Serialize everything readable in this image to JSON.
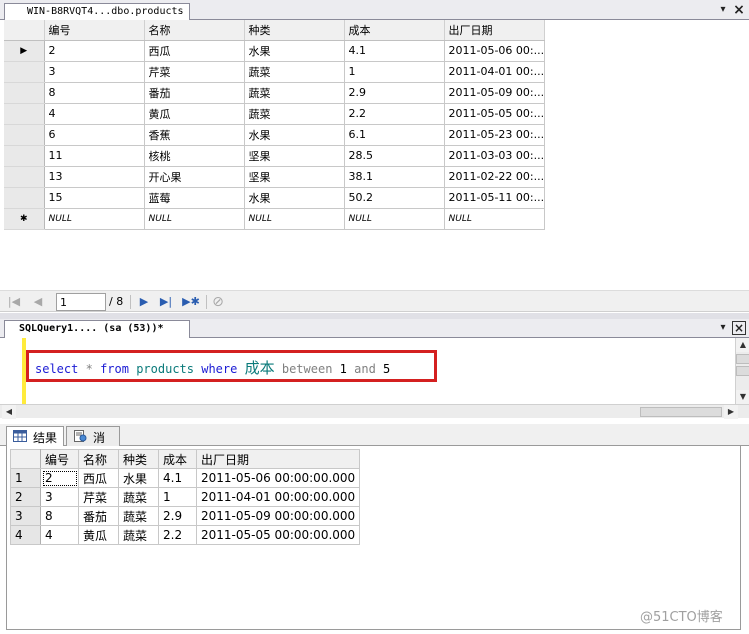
{
  "top_tab": {
    "title": "WIN-B8RVQT4...dbo.products"
  },
  "products_grid": {
    "columns": [
      "编号",
      "名称",
      "种类",
      "成本",
      "出厂日期"
    ],
    "rows": [
      [
        "2",
        "西瓜",
        "水果",
        "4.1",
        "2011-05-06 00:..."
      ],
      [
        "3",
        "芹菜",
        "蔬菜",
        "1",
        "2011-04-01 00:..."
      ],
      [
        "8",
        "番茄",
        "蔬菜",
        "2.9",
        "2011-05-09 00:..."
      ],
      [
        "4",
        "黄瓜",
        "蔬菜",
        "2.2",
        "2011-05-05 00:..."
      ],
      [
        "6",
        "香蕉",
        "水果",
        "6.1",
        "2011-05-23 00:..."
      ],
      [
        "11",
        "核桃",
        "坚果",
        "28.5",
        "2011-03-03 00:..."
      ],
      [
        "13",
        "开心果",
        "坚果",
        "38.1",
        "2011-02-22 00:..."
      ],
      [
        "15",
        "蓝莓",
        "水果",
        "50.2",
        "2011-05-11 00:..."
      ]
    ],
    "new_row_marker": "✱",
    "null_text": "NULL"
  },
  "navigator": {
    "current_page": "1",
    "page_total": "/ 8"
  },
  "query_tab": {
    "title": "SQLQuery1....  (sa (53))*"
  },
  "sql": {
    "select": "select",
    "star": "*",
    "from": "from",
    "table": "products",
    "where": "where",
    "column": "成本",
    "between": "between",
    "low": "1",
    "and": "and",
    "high": "5"
  },
  "result_tabs": {
    "results": "结果",
    "messages": "消息"
  },
  "result_grid": {
    "columns": [
      "编号",
      "名称",
      "种类",
      "成本",
      "出厂日期"
    ],
    "rows": [
      {
        "num": "1",
        "cells": [
          "2",
          "西瓜",
          "水果",
          "4.1",
          "2011-05-06 00:00:00.000"
        ]
      },
      {
        "num": "2",
        "cells": [
          "3",
          "芹菜",
          "蔬菜",
          "1",
          "2011-04-01 00:00:00.000"
        ]
      },
      {
        "num": "3",
        "cells": [
          "8",
          "番茄",
          "蔬菜",
          "2.9",
          "2011-05-09 00:00:00.000"
        ]
      },
      {
        "num": "4",
        "cells": [
          "4",
          "黄瓜",
          "蔬菜",
          "2.2",
          "2011-05-05 00:00:00.000"
        ]
      }
    ]
  },
  "watermark": "@51CTO博客",
  "icons": {
    "dropdown": "▾",
    "close": "×",
    "pin": "▾",
    "first": "|◀",
    "prev": "◀",
    "next": "▶",
    "last": "▶|",
    "new": "▶✱",
    "stop": "⊘"
  }
}
